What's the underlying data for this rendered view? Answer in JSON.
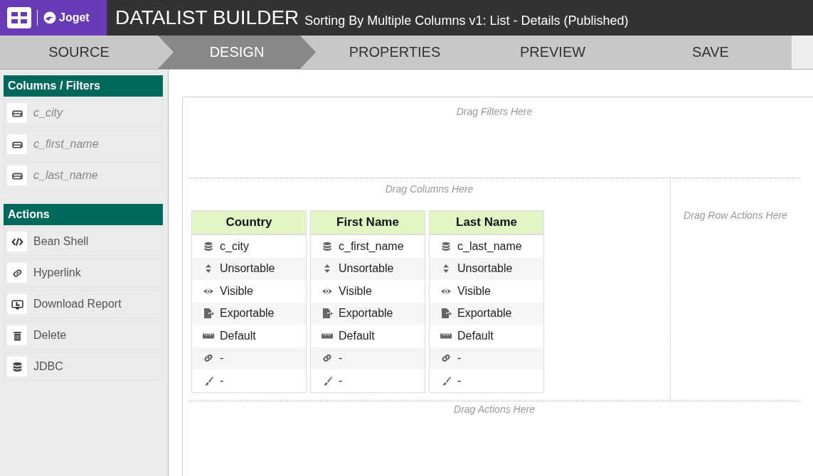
{
  "header": {
    "logo_text": "Joget",
    "title": "DATALIST BUILDER",
    "subtitle": "Sorting By Multiple Columns v1: List - Details (Published)"
  },
  "steps": [
    {
      "label": "SOURCE",
      "selected": false
    },
    {
      "label": "DESIGN",
      "selected": true
    },
    {
      "label": "PROPERTIES",
      "selected": false
    },
    {
      "label": "PREVIEW",
      "selected": false
    },
    {
      "label": "SAVE",
      "selected": false
    }
  ],
  "sidebar": {
    "sections": [
      {
        "title": "Columns / Filters",
        "items": [
          {
            "kind": "column",
            "label": "c_city"
          },
          {
            "kind": "column",
            "label": "c_first_name"
          },
          {
            "kind": "column",
            "label": "c_last_name"
          }
        ]
      },
      {
        "title": "Actions",
        "items": [
          {
            "kind": "code",
            "label": "Bean Shell"
          },
          {
            "kind": "link",
            "label": "Hyperlink"
          },
          {
            "kind": "download",
            "label": "Download Report"
          },
          {
            "kind": "delete",
            "label": "Delete"
          },
          {
            "kind": "database",
            "label": "JDBC"
          }
        ]
      }
    ]
  },
  "canvas": {
    "filters_hint": "Drag Filters Here",
    "columns_hint": "Drag Columns Here",
    "row_actions_hint": "Drag Row Actions Here",
    "actions_hint": "Drag Actions Here",
    "columns": [
      {
        "header": "Country",
        "properties": [
          {
            "kind": "field",
            "text": "c_city"
          },
          {
            "kind": "sort",
            "text": "Unsortable"
          },
          {
            "kind": "visibility",
            "text": "Visible"
          },
          {
            "kind": "export",
            "text": "Exportable"
          },
          {
            "kind": "width",
            "text": "Default"
          },
          {
            "kind": "link",
            "text": "-"
          },
          {
            "kind": "style",
            "text": "-"
          }
        ]
      },
      {
        "header": "First Name",
        "properties": [
          {
            "kind": "field",
            "text": "c_first_name"
          },
          {
            "kind": "sort",
            "text": "Unsortable"
          },
          {
            "kind": "visibility",
            "text": "Visible"
          },
          {
            "kind": "export",
            "text": "Exportable"
          },
          {
            "kind": "width",
            "text": "Default"
          },
          {
            "kind": "link",
            "text": "-"
          },
          {
            "kind": "style",
            "text": "-"
          }
        ]
      },
      {
        "header": "Last Name",
        "properties": [
          {
            "kind": "field",
            "text": "c_last_name"
          },
          {
            "kind": "sort",
            "text": "Unsortable"
          },
          {
            "kind": "visibility",
            "text": "Visible"
          },
          {
            "kind": "export",
            "text": "Exportable"
          },
          {
            "kind": "width",
            "text": "Default"
          },
          {
            "kind": "link",
            "text": "-"
          },
          {
            "kind": "style",
            "text": "-"
          }
        ]
      }
    ]
  }
}
